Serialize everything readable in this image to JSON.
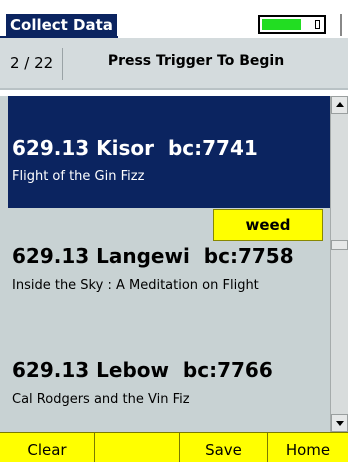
{
  "app": {
    "title": "Collect Data"
  },
  "battery": {
    "level": 0.78,
    "color": "#22dd22"
  },
  "status": {
    "counter": "2 / 22",
    "prompt": "Press Trigger To Begin"
  },
  "list": {
    "items": [
      {
        "call_number": "629.13 Kisor",
        "barcode": "bc:7741",
        "subtitle": "Flight of the Gin Fizz",
        "selected": true
      },
      {
        "call_number": "629.13 Langewi",
        "barcode": "bc:7758",
        "subtitle": "Inside the Sky : A Meditation on Flight",
        "selected": false
      },
      {
        "call_number": "629.13 Lebow",
        "barcode": "bc:7766",
        "subtitle": "Cal Rodgers and the Vin Fiz",
        "selected": false
      }
    ],
    "tag": "weed"
  },
  "colors": {
    "selection": "#0b2460",
    "list_bg": "#c8d2d3",
    "softkey_bg": "#ffff00"
  },
  "softkeys": {
    "clear": "Clear",
    "blank": "",
    "save": "Save",
    "home": "Home"
  }
}
